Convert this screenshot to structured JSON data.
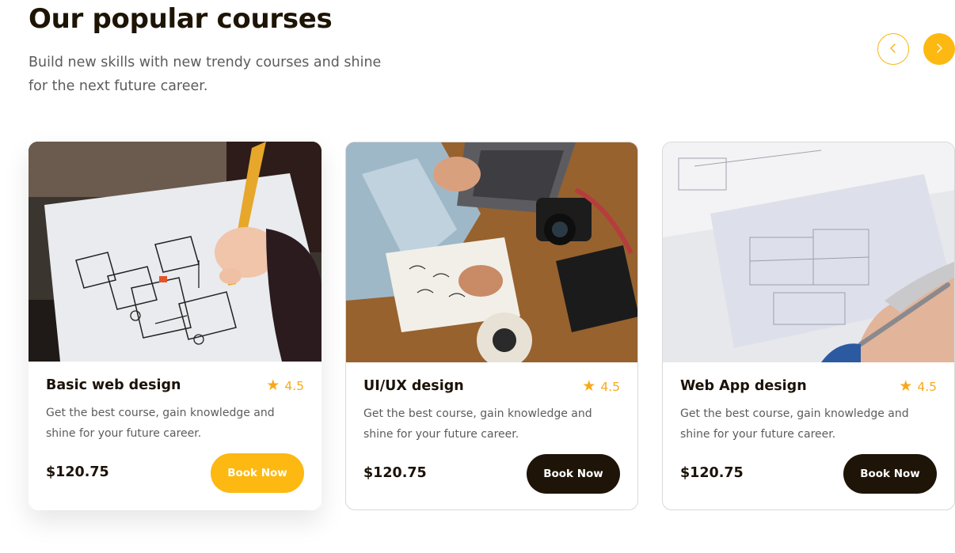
{
  "header": {
    "title": "Our popular courses",
    "subtitle": "Build new skills with new trendy courses and shine for the next future career."
  },
  "carousel_nav": {
    "prev_icon": "chevron-left-icon",
    "next_icon": "chevron-right-icon"
  },
  "courses": [
    {
      "title": "Basic web design",
      "rating": "4.5",
      "description": "Get the best course, gain knowledge and shine for your future career.",
      "price": "$120.75",
      "button_label": "Book Now",
      "image": "hand sketching website wireframes with orange pen"
    },
    {
      "title": "UI/UX design",
      "rating": "4.5",
      "description": "Get the best course, gain knowledge and shine for your future career.",
      "price": "$120.75",
      "button_label": "Book Now",
      "image": "designer drawing in notebook on wooden desk with laptop and camera"
    },
    {
      "title": "Web App design",
      "rating": "4.5",
      "description": "Get the best course, gain knowledge and shine for your future career.",
      "price": "$120.75",
      "button_label": "Book Now",
      "image": "hand drawing architectural blueprints with pen"
    }
  ],
  "colors": {
    "accent": "#fdb812",
    "dark": "#1e1407",
    "star": "#f8a91a",
    "muted_text": "#5c5c5c"
  }
}
